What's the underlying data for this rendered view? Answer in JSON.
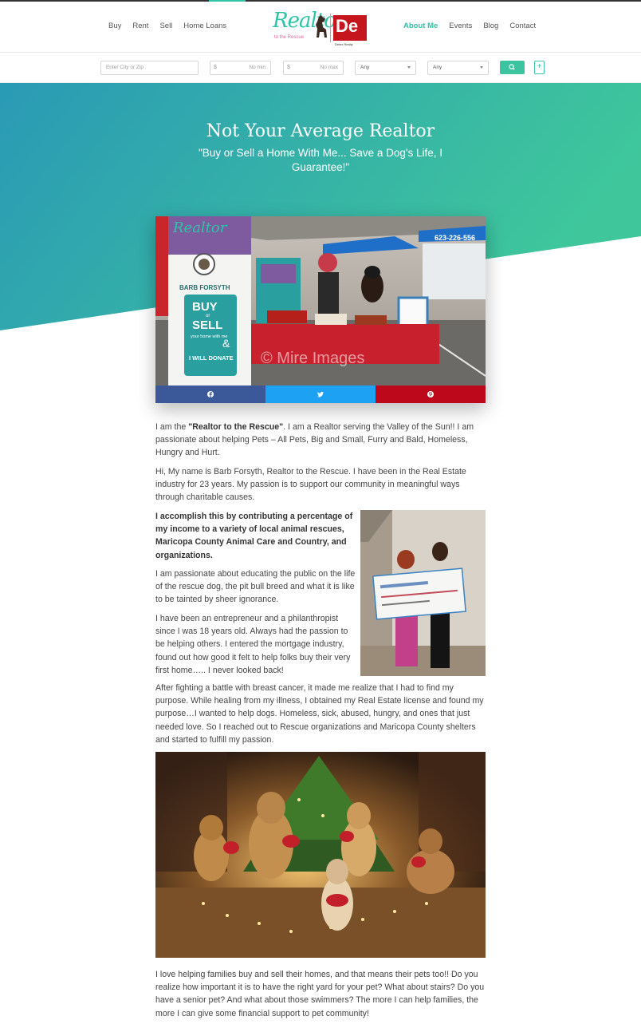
{
  "nav": {
    "left": [
      "Buy",
      "Rent",
      "Sell",
      "Home Loans"
    ],
    "right": [
      "About Me",
      "Events",
      "Blog",
      "Contact"
    ],
    "active": "About Me"
  },
  "logo": {
    "script": "Realtor",
    "sub": "to the Rescue",
    "brand": "De",
    "brand_sub": "Delex Realty"
  },
  "search": {
    "location_placeholder": "Enter City or Zip",
    "min_currency": "$",
    "min_placeholder": "No min",
    "max_currency": "$",
    "max_placeholder": "No max",
    "beds_value": "Any",
    "baths_value": "Any",
    "search_icon": "search-icon",
    "more_label": "+"
  },
  "hero": {
    "title": "Not Your Average Realtor",
    "subtitle": "\"Buy or Sell a Home With Me... Save a Dog's Life, I Guarantee!\""
  },
  "event_photo": {
    "banner_name": "BARB FORSYTH",
    "banner_buy": "BUY",
    "banner_or": "or",
    "banner_sell": "SELL",
    "banner_line": "your home with me",
    "banner_amp": "&",
    "banner_donate": "I WILL DONATE",
    "phone": "623-226-556",
    "watermark": "© Mire Images"
  },
  "share": {
    "facebook_icon": "facebook-icon",
    "twitter_icon": "twitter-icon",
    "pinterest_icon": "pinterest-icon"
  },
  "content": {
    "p1_a": "I am the ",
    "p1_bold": "\"Realtor to the Rescue\"",
    "p1_b": ". I am a Realtor serving the Valley of the Sun!! I am passionate about helping Pets – All Pets, Big and Small, Furry and Bald, Homeless, Hungry and Hurt.",
    "p2": "Hi, My name is Barb Forsyth,  Realtor to the Rescue. I have been in the Real Estate industry for 23 years. My passion is to support our community in meaningful ways through charitable causes.",
    "p3": "I accomplish this by contributing a percentage of my income to a variety of  local  animal rescues, Maricopa County Animal Care and Country, and organizations.",
    "p4": "I am passionate about educating the public on the life of the rescue dog, the pit bull breed and what it is like to be tainted by sheer ignorance.",
    "p5": "I have been an entrepreneur and a philanthropist since I was 18 years old.  Always had the passion to be helping others.  I entered the mortgage industry, found out how good it felt to help folks buy their very first home….. I never looked back!",
    "p6": "After fighting a battle with breast cancer,  it made me realize that I had to find my purpose.  While healing from my illness, I obtained my Real Estate license and found my purpose…I wanted to help dogs. Homeless, sick, abused, hungry, and ones that just needed love.  So I reached out to Rescue organizations and Maricopa County shelters and started to fulfill my passion.",
    "p7": "I love helping families buy and sell their homes, and that means their pets too!!  Do you realize how important it is to have the right yard for your pet?  What about stairs?  Do you have a senior pet?  And what about those swimmers? The more I can help families, the more I can give some financial support to pet community!"
  },
  "colors": {
    "accent": "#2fc4a6",
    "hero_gradient_start": "#2a9ab5",
    "hero_gradient_end": "#3fc79b",
    "facebook": "#3b5998",
    "twitter": "#1da1f2",
    "pinterest": "#bd081c"
  }
}
